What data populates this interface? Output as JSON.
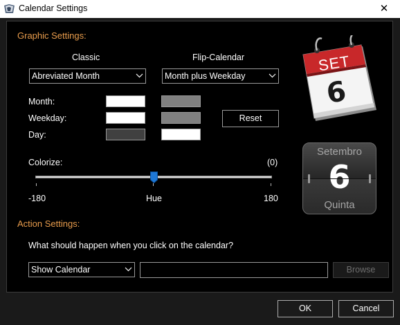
{
  "window": {
    "title": "Calendar Settings",
    "close_glyph": "✕",
    "icon": "calendar-app-icon"
  },
  "graphic": {
    "heading": "Graphic Settings:",
    "classic_label": "Classic",
    "flip_label": "Flip-Calendar",
    "classic_select": "Abreviated Month",
    "flip_select": "Month plus Weekday",
    "rows": [
      {
        "label": "Month:",
        "classic_color": "#ffffff",
        "flip_color": "#808080"
      },
      {
        "label": "Weekday:",
        "classic_color": "#ffffff",
        "flip_color": "#808080"
      },
      {
        "label": "Day:",
        "classic_color": "#404040",
        "flip_color": "#ffffff"
      }
    ],
    "reset_label": "Reset",
    "colorize_label": "Colorize:",
    "colorize_value_text": "(0)",
    "slider": {
      "min": -180,
      "max": 180,
      "value": 0
    },
    "slider_min_label": "-180",
    "slider_mid_label": "Hue",
    "slider_max_label": "180"
  },
  "preview_classic": {
    "month": "SET",
    "day": "6"
  },
  "preview_flip": {
    "month": "Setembro",
    "day": "6",
    "weekday": "Quinta"
  },
  "action": {
    "heading": "Action Settings:",
    "question": "What should happen when you click on the calendar?",
    "select_value": "Show Calendar",
    "path_value": "",
    "browse_label": "Browse"
  },
  "footer": {
    "ok_label": "OK",
    "cancel_label": "Cancel"
  },
  "colors": {
    "accent": "#e89c4c",
    "slider_thumb": "#1e78d6",
    "calendar_red": "#c8282a"
  }
}
